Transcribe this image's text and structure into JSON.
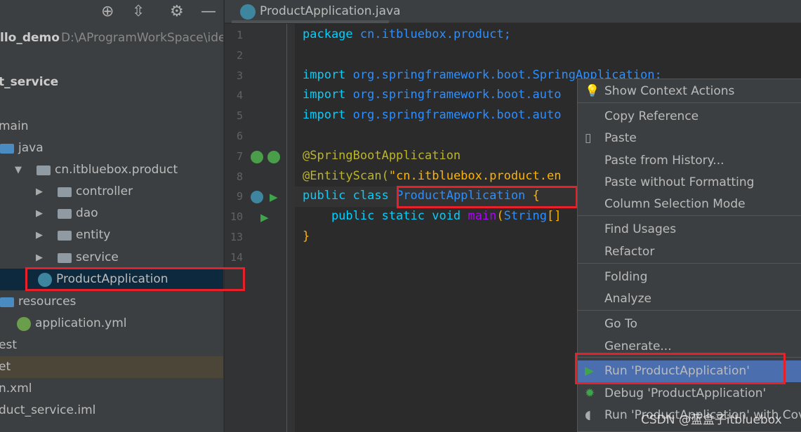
{
  "toolbar": {
    "icons": [
      "locate-icon",
      "collapse-icon",
      "gear-icon",
      "minimize-icon"
    ]
  },
  "project": {
    "name": "llo_demo",
    "path": "D:\\AProgramWorkSpace\\ide"
  },
  "tree": [
    {
      "label": "t_service",
      "bold": true
    },
    {
      "label": "main"
    },
    {
      "label": "java"
    },
    {
      "label": "cn.itbluebox.product"
    },
    {
      "label": "controller"
    },
    {
      "label": "dao"
    },
    {
      "label": "entity"
    },
    {
      "label": "service"
    },
    {
      "label": "ProductApplication",
      "selected": true
    },
    {
      "label": "resources"
    },
    {
      "label": "application.yml"
    },
    {
      "label": "est"
    },
    {
      "label": "et"
    },
    {
      "label": "n.xml"
    },
    {
      "label": "duct_service.iml"
    }
  ],
  "tab": {
    "label": "ProductApplication.java",
    "close": "✕"
  },
  "editor": {
    "line_numbers": [
      "1",
      "2",
      "3",
      "4",
      "5",
      "6",
      "7",
      "8",
      "9",
      "10",
      "13",
      "14"
    ],
    "lines": [
      [
        {
          "t": "package ",
          "c": "kw"
        },
        {
          "t": "cn.itbluebox.product;",
          "c": "cls"
        }
      ],
      [],
      [
        {
          "t": "import ",
          "c": "kw"
        },
        {
          "t": "org.springframework.boot.SpringApplication;",
          "c": "cls"
        }
      ],
      [
        {
          "t": "import ",
          "c": "kw"
        },
        {
          "t": "org.springframework.boot.auto",
          "c": "cls"
        }
      ],
      [
        {
          "t": "import ",
          "c": "kw"
        },
        {
          "t": "org.springframework.boot.auto",
          "c": "cls"
        }
      ],
      [],
      [
        {
          "t": "@SpringBootApplication",
          "c": "ann"
        }
      ],
      [
        {
          "t": "@EntityScan(",
          "c": "ann"
        },
        {
          "t": "\"cn.itbluebox.product.en",
          "c": "str"
        }
      ],
      [
        {
          "t": "public class ",
          "c": "kw"
        },
        {
          "t": "ProductApplication ",
          "c": "cls"
        },
        {
          "t": "{",
          "c": "str"
        }
      ],
      [
        {
          "t": "    public static void ",
          "c": "kw"
        },
        {
          "t": "main",
          "c": "fn"
        },
        {
          "t": "(",
          "c": "str"
        },
        {
          "t": "String",
          "c": "cls"
        },
        {
          "t": "[]",
          "c": "str"
        }
      ],
      [
        {
          "t": "}",
          "c": "str"
        }
      ],
      []
    ]
  },
  "context_menu": {
    "items": [
      {
        "label": "Show Context Actions",
        "icon": "lightbulb-icon"
      },
      {
        "label": "Copy Reference"
      },
      {
        "label": "Paste",
        "icon": "clipboard-icon"
      },
      {
        "label": "Paste from History..."
      },
      {
        "label": "Paste without Formatting"
      },
      {
        "label": "Column Selection Mode"
      },
      {
        "label": "Find Usages"
      },
      {
        "label": "Refactor"
      },
      {
        "label": "Folding"
      },
      {
        "label": "Analyze"
      },
      {
        "label": "Go To"
      },
      {
        "label": "Generate..."
      },
      {
        "label": "Run 'ProductApplication'",
        "icon": "run-icon",
        "highlighted": true
      },
      {
        "label": "Debug 'ProductApplication'",
        "icon": "debug-icon"
      },
      {
        "label": "Run 'ProductApplication' with Cove",
        "icon": "coverage-icon"
      }
    ]
  },
  "watermark": "CSDN @蓝盒子itbluebox",
  "colors": {
    "highlight": "#4b6eaf",
    "annotation_box": "#e8202a",
    "selection": "#0d293e"
  }
}
